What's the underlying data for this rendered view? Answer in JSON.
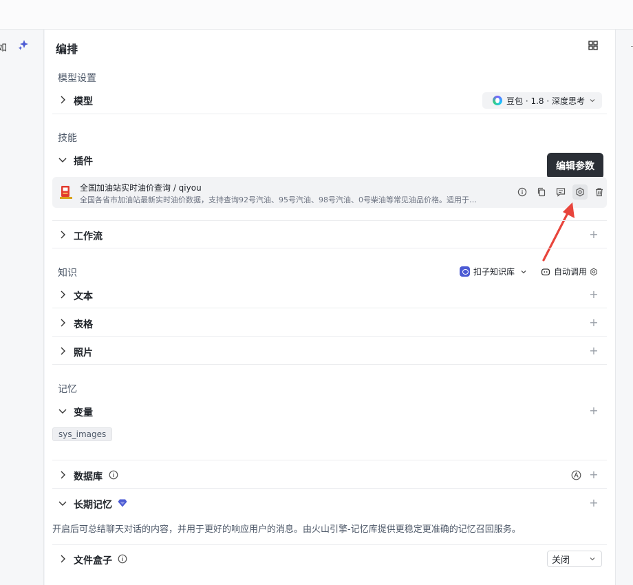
{
  "left_strip": {
    "partial_char": "如"
  },
  "panel": {
    "title": "编排",
    "model_section": {
      "label": "模型设置",
      "model_row": {
        "label": "模型",
        "selected_model": "豆包 · 1.8 · 深度思考"
      }
    },
    "skills_section": {
      "label": "技能",
      "plugins_row": {
        "label": "插件"
      },
      "plugin": {
        "name": "全国加油站实时油价查询 / qiyou",
        "description": "全国各省市加油站最新实时油价数据，支持查询92号汽油、95号汽油、98号汽油、0号柴油等常见油品价格。适用于…"
      },
      "tooltip": "编辑参数",
      "workflow_row": {
        "label": "工作流"
      }
    },
    "knowledge_section": {
      "label": "知识",
      "kb_selector": "扣子知识库",
      "auto_call": "自动调用",
      "rows": [
        {
          "label": "文本"
        },
        {
          "label": "表格"
        },
        {
          "label": "照片"
        }
      ]
    },
    "memory_section": {
      "label": "记忆",
      "variables_row": {
        "label": "变量",
        "tag": "sys_images"
      },
      "database_row": {
        "label": "数据库"
      },
      "long_memory_row": {
        "label": "长期记忆",
        "note": "开启后可总结聊天对话的内容，并用于更好的响应用户的消息。由火山引擎-记忆库提供更稳定更准确的记忆召回服务。"
      },
      "file_box_row": {
        "label": "文件盒子",
        "value": "关闭"
      }
    }
  },
  "colors": {
    "accent": "#4c5bd4",
    "arrow": "#e8453c",
    "tooltip_bg": "#2b2f36"
  }
}
